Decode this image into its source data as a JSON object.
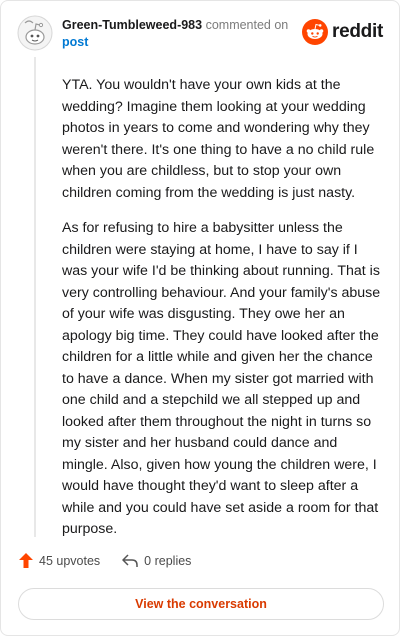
{
  "comment": {
    "username": "Green-Tumbleweed-983",
    "commented_on": "commented on",
    "post_link": "post",
    "paragraphs": [
      "YTA. You wouldn't have your own kids at the wedding? Imagine them looking at your wedding photos in years to come and wondering why they weren't there. It's one thing to have a no child rule when you are childless, but to stop your own children coming from the wedding is just nasty.",
      "As for refusing to hire a babysitter unless the children were staying at home, I have to say if I was your wife I'd be thinking about running. That is very controlling behaviour. And your family's abuse of your wife was disgusting. They owe her an apology big time. They could have looked after the children for a little while and given her the chance to have a dance. When my sister got married with one child and a stepchild we all stepped up and looked after them throughout the night in turns so my sister and her husband could dance and mingle. Also, given how young the children were, I would have thought they'd want to sleep after a while and you could have set aside a room for that purpose."
    ]
  },
  "brand": {
    "name": "reddit",
    "color": "#ff4500"
  },
  "actions": {
    "upvotes": "45 upvotes",
    "replies": "0 replies"
  },
  "view_button": "View the conversation",
  "colors": {
    "accent": "#d93a00",
    "link": "#0079d3",
    "upvote": "#ff4500"
  }
}
